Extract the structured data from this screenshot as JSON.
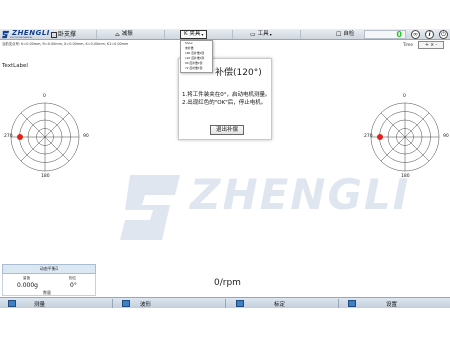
{
  "header": {
    "logo_text": "ZHENGLI",
    "logo_sub": "ELECTROMECHANICAL",
    "product_label": "卧支撑",
    "buttons": {
      "product_icon": "window-icon",
      "reduce": "减振",
      "fixture": "K 夹具",
      "tools": "工具",
      "self_check": "自检"
    },
    "counter": "0",
    "right_icons": [
      "link-icon",
      "info-icon",
      "power-icon"
    ],
    "colors": {
      "counter": "#25c225",
      "brand": "#123f8e"
    }
  },
  "infostrip": {
    "text": "当前支点号:  K=0.00mm,  R=0.00mm,  X=0.00mm,  K=0.00mm,  K1=0.00mm"
  },
  "time_label": "Time",
  "zoom_label": "+ x -",
  "text_label": "TextLabel",
  "fixture_menu": {
    "items": [
      "Show",
      "未补偿",
      "180 度补偿1键",
      "120 度补偿1键",
      "90 度补偿1键",
      "72 度补偿1键"
    ]
  },
  "dialog": {
    "title": "补偿(120°)",
    "message_line1": "1.将工件装夹在0°，启动电机测量。",
    "message_line2": "2.出现红色的\"OK\"后，停止电机。",
    "exit_button": "退出补偿"
  },
  "polar_left": {
    "labels": {
      "top": "0",
      "right": "90",
      "bottom": "180",
      "left": "270"
    },
    "point_color": "#e0221a"
  },
  "polar_right": {
    "labels": {
      "top": "0",
      "right": "90",
      "bottom": "180",
      "left": "270"
    },
    "point_color": "#e0221a"
  },
  "bottom_panel": {
    "header": "动态平衡1",
    "col1_label": "量值",
    "col2_label": "相位",
    "value": "0.000g",
    "angle": "0°",
    "footer": "数量"
  },
  "rpm": "0/rpm",
  "bottom_nav": {
    "items": [
      "测量",
      "波形",
      "标定",
      "设置"
    ]
  }
}
